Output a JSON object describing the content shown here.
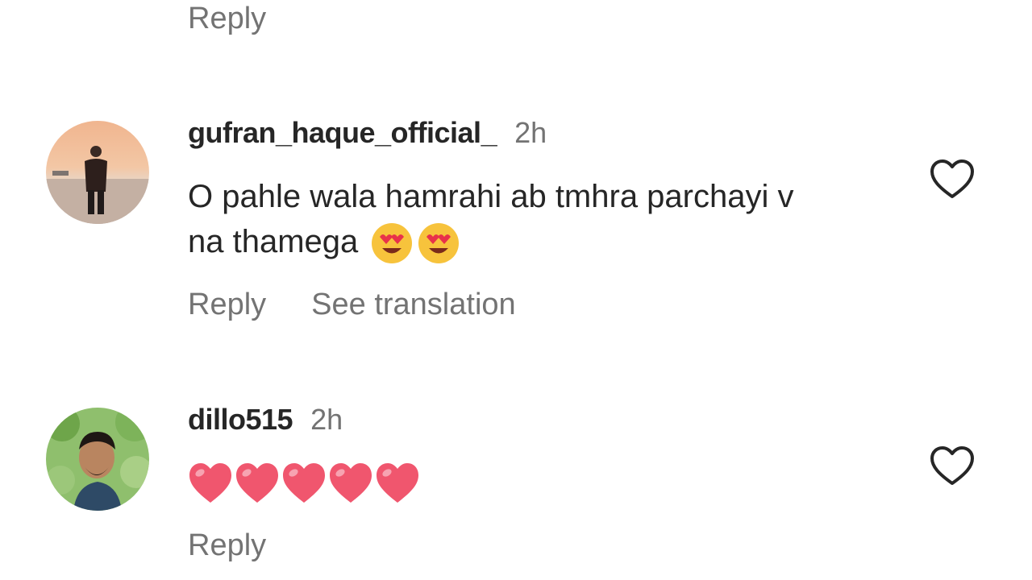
{
  "top": {
    "reply_label": "Reply"
  },
  "comments": [
    {
      "username": "gufran_haque_official_",
      "time": "2h",
      "text": "O pahle wala hamrahi ab tmhra parchayi v na thamega",
      "emojis": [
        "heart-eyes-emoji",
        "heart-eyes-emoji"
      ],
      "reply_label": "Reply",
      "see_translation_label": "See translation",
      "like_icon": "heart-outline-icon"
    },
    {
      "username": "dillo515",
      "time": "2h",
      "emojis": [
        "red-heart-emoji",
        "red-heart-emoji",
        "red-heart-emoji",
        "red-heart-emoji",
        "red-heart-emoji"
      ],
      "reply_label": "Reply",
      "like_icon": "heart-outline-icon"
    }
  ],
  "colors": {
    "text_primary": "#262626",
    "text_secondary": "#737373",
    "heart_red": "#f0566e"
  }
}
